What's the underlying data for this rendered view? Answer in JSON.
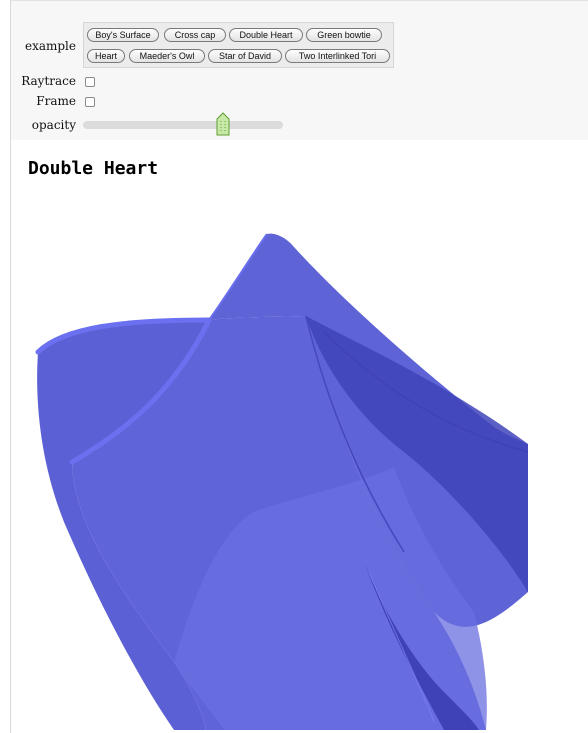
{
  "controls": {
    "example_label": "example",
    "raytrace_label": "Raytrace",
    "frame_label": "Frame",
    "opacity_label": "opacity",
    "example_buttons": [
      "Boy's Surface",
      "Cross cap",
      "Double Heart",
      "Green bowtie",
      "Heart",
      "Maeder's Owl",
      "Star of David",
      "Two Interlinked Tori"
    ],
    "raytrace_checked": false,
    "frame_checked": false,
    "opacity_value": 0.7
  },
  "plot": {
    "title": "Double Heart",
    "surface_color": "#5055d8",
    "surface_edge_color": "#6b70f0"
  }
}
